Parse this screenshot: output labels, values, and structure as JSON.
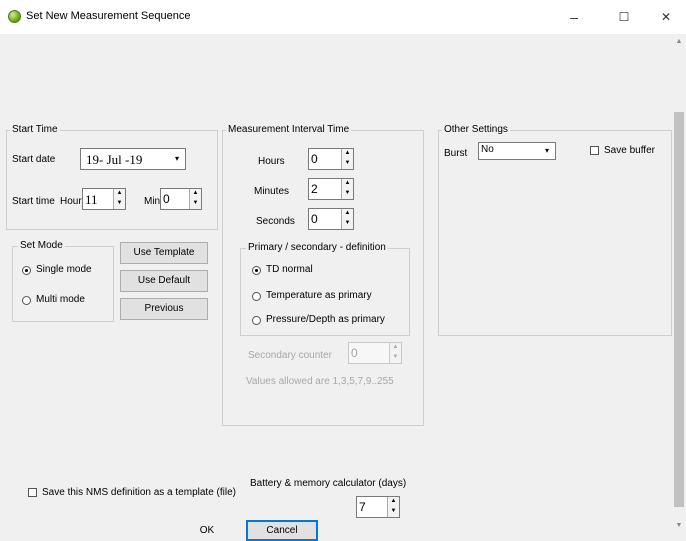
{
  "window": {
    "title": "Set New Measurement Sequence"
  },
  "window_controls": {
    "minimize": "–",
    "maximize": "☐",
    "close": "✕"
  },
  "scrollbar": {
    "up": "▲",
    "down": "▼"
  },
  "arrows": {
    "up": "▲",
    "down": "▼",
    "dropdown": "▾"
  },
  "start_time": {
    "group_label": "Start Time",
    "start_date_label": "Start date",
    "start_date_value": "19- Jul -19",
    "start_time_label": "Start time",
    "hour_label": "Hour",
    "hour_value": "11",
    "min_label": "Min",
    "min_value": "0"
  },
  "set_mode": {
    "group_label": "Set Mode",
    "single_label": "Single mode",
    "multi_label": "Multi mode",
    "selected": "Single mode"
  },
  "buttons": {
    "use_template": "Use Template",
    "use_default": "Use Default",
    "previous": "Previous",
    "ok": "OK",
    "cancel": "Cancel"
  },
  "interval": {
    "group_label": "Measurement Interval Time",
    "hours_label": "Hours",
    "hours_value": "0",
    "minutes_label": "Minutes",
    "minutes_value": "2",
    "seconds_label": "Seconds",
    "seconds_value": "0"
  },
  "primary": {
    "group_label": "Primary / secondary - definition",
    "td_label": "TD normal",
    "temp_label": "Temperature as primary",
    "pressure_label": "Pressure/Depth as primary",
    "selected": "TD normal"
  },
  "secondary": {
    "counter_label": "Secondary counter",
    "counter_value": "0",
    "allowed_text": "Values allowed are 1,3,5,7,9..255"
  },
  "other": {
    "group_label": "Other Settings",
    "burst_label": "Burst",
    "burst_value": "No",
    "save_buffer_label": "Save buffer"
  },
  "bottom": {
    "save_template_label": "Save this NMS definition as a template (file)",
    "battery_label": "Battery & memory calculator (days)",
    "battery_value": "7"
  }
}
